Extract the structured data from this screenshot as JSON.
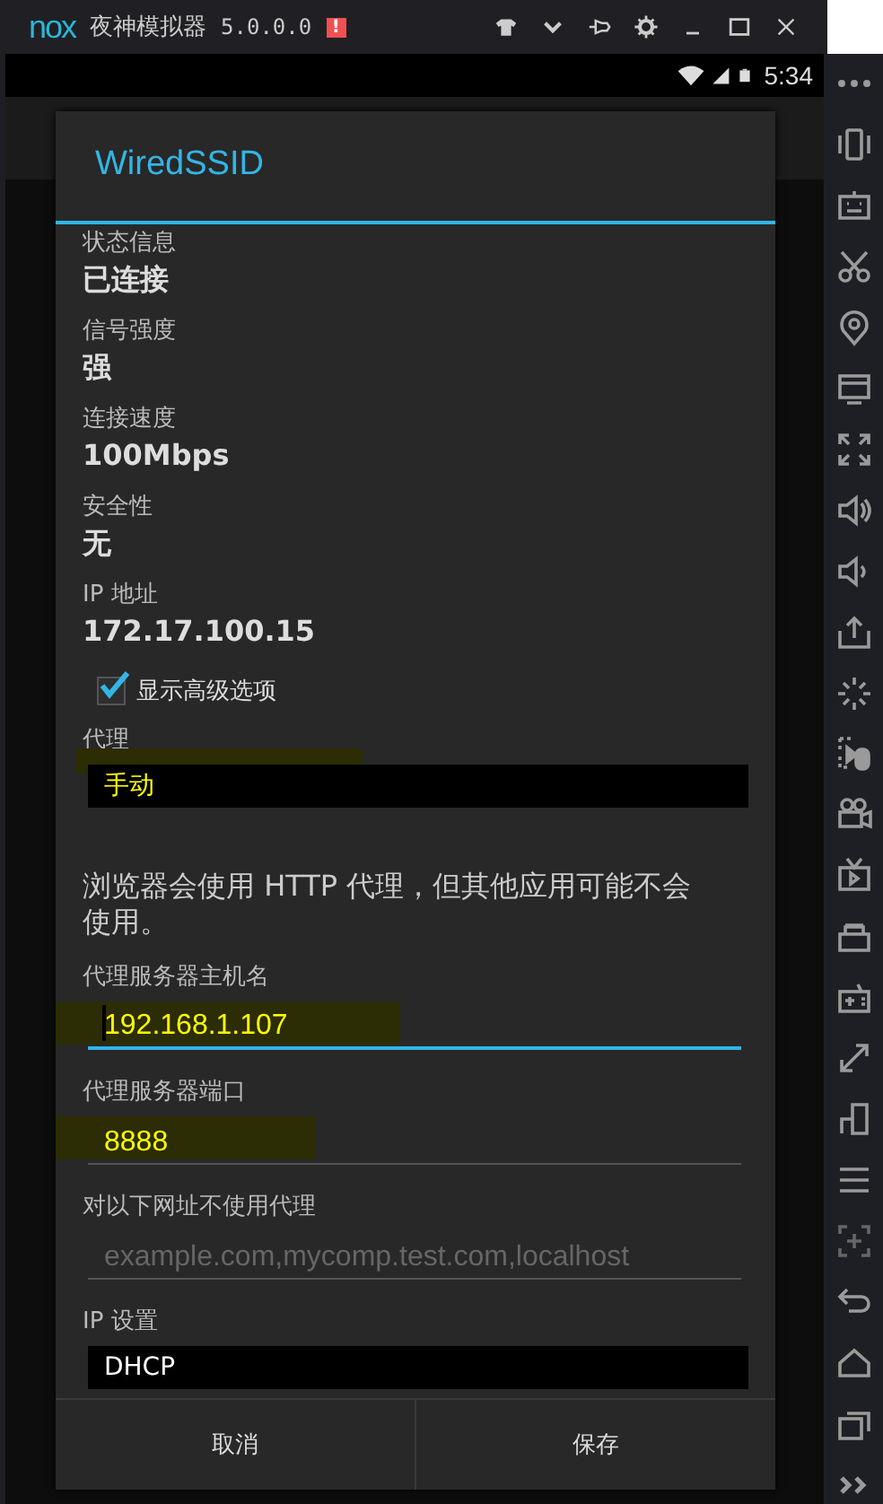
{
  "emulator": {
    "logo": "nox",
    "title": "夜神模拟器",
    "version": "5.0.0.0",
    "alert": "!"
  },
  "status_bar": {
    "time": "5:34"
  },
  "dialog": {
    "title": "WiredSSID",
    "info": [
      {
        "label": "状态信息",
        "value": "已连接"
      },
      {
        "label": "信号强度",
        "value": "强"
      },
      {
        "label": "连接速度",
        "value": "100Mbps"
      },
      {
        "label": "安全性",
        "value": "无"
      },
      {
        "label": "IP 地址",
        "value": "172.17.100.15"
      }
    ],
    "advanced": {
      "label": "显示高级选项",
      "checked": true
    },
    "proxy": {
      "label": "代理",
      "value": "手动",
      "highlighted": true
    },
    "note": "浏览器会使用 HTTP 代理，但其他应用可能不会使用。",
    "fields": [
      {
        "label": "代理服务器主机名",
        "value": "192.168.1.107",
        "highlighted": true,
        "focused": true
      },
      {
        "label": "代理服务器端口",
        "value": "8888",
        "highlighted": true,
        "focused": false
      },
      {
        "label": "对以下网址不使用代理",
        "placeholder": "example.com,mycomp.test.com,localhost",
        "highlighted": false,
        "focused": false
      }
    ],
    "ip_settings": {
      "label": "IP 设置",
      "value": "DHCP",
      "highlighted": false
    },
    "buttons": [
      "取消",
      "保存"
    ]
  }
}
